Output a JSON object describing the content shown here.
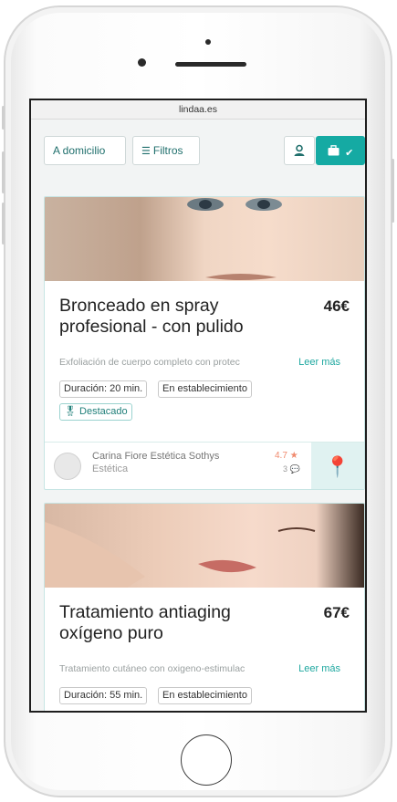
{
  "browser": {
    "url": "lindaa.es"
  },
  "toolbar": {
    "domicilio_label": "A domicilio",
    "filtros_label": "Filtros",
    "filtros_icon": "sliders-icon",
    "user_icon": "user-icon",
    "business_icon": "briefcase-icon",
    "check_icon": "check-icon"
  },
  "badge_icon": "award-icon",
  "accent_color": "#15aaa3",
  "cards": [
    {
      "title": "Bronceado en spray profesional - con pulido",
      "price": "46€",
      "description": "Exfoliación de cuerpo completo con protec",
      "read_more": "Leer más",
      "tags": [
        "Duración: 20 min.",
        "En establecimiento"
      ],
      "featured": "Destacado",
      "provider": {
        "name": "Carina Fiore Estética Sothys",
        "category": "Estética",
        "rating": "4.7",
        "reviews": "3"
      }
    },
    {
      "title": "Tratamiento antiaging oxígeno puro",
      "price": "67€",
      "description": "Tratamiento cutáneo con oxigeno-estimulac",
      "read_more": "Leer más",
      "tags": [
        "Duración: 55 min.",
        "En establecimiento"
      ]
    }
  ]
}
